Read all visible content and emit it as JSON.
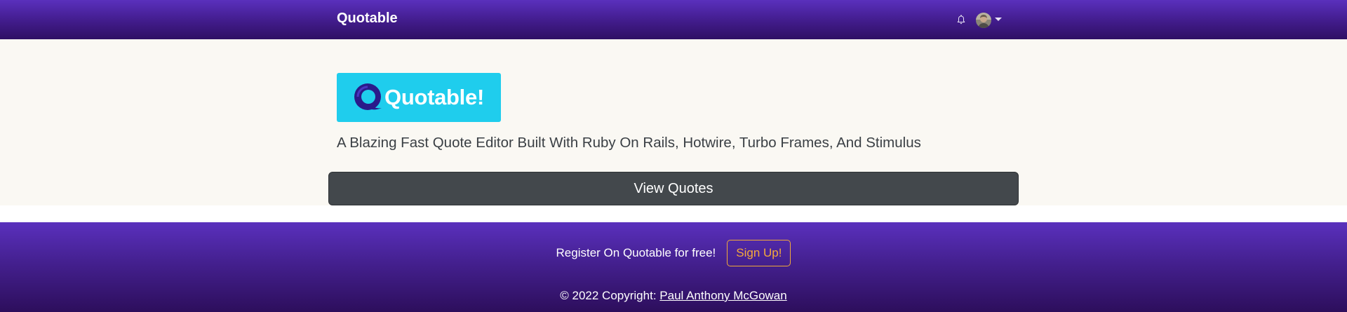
{
  "navbar": {
    "brand": "Quotable",
    "bell_icon": "bell-icon",
    "avatar_icon": "user-avatar",
    "dropdown_icon": "caret-down-icon"
  },
  "hero": {
    "logo_text": "Quotable!",
    "tagline": "A Blazing Fast Quote Editor Built With Ruby On Rails, Hotwire, Turbo Frames, And Stimulus",
    "view_button": "View Quotes"
  },
  "footer": {
    "cta_text": "Register On Quotable for free!",
    "signup_button": "Sign Up!",
    "copyright_prefix": "© 2022 Copyright:",
    "copyright_author": "Paul Anthony McGowan"
  },
  "colors": {
    "nav_gradient_top": "#5a30bd",
    "nav_gradient_bottom": "#2f1064",
    "hero_bg": "#faf8f3",
    "logo_bg": "#1fcded",
    "button_dark": "#43484c",
    "signup_accent": "#f5a93b"
  }
}
